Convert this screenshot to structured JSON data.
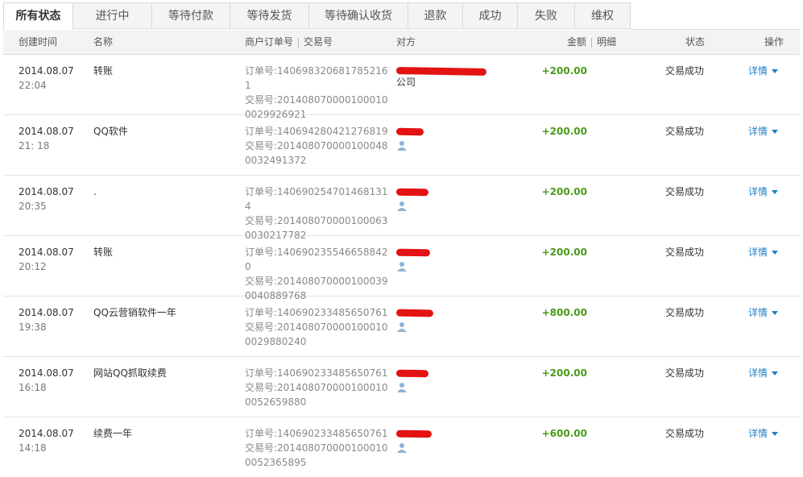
{
  "tabs": [
    "所有状态",
    "进行中",
    "等待付款",
    "等待发货",
    "等待确认收货",
    "退款",
    "成功",
    "失败",
    "维权"
  ],
  "columns": {
    "created": "创建时间",
    "name": "名称",
    "merchant_order": "商户订单号",
    "trade_no": "交易号",
    "party": "对方",
    "amount": "金额",
    "detail": "明细",
    "status": "状态",
    "action": "操作"
  },
  "rows": [
    {
      "date": "2014.08.07",
      "time": "22:04",
      "name": "转账",
      "order": "订单号:140698320681785216​1",
      "trade": "交易号:2014080700001000100029926921",
      "party_tail": "公司",
      "amount": "+200.00",
      "status": "交易成功",
      "op": "详情"
    },
    {
      "date": "2014.08.07",
      "time": "21: 18",
      "name": "QQ软件",
      "order": "订单号:140694280421276819",
      "trade": "交易号:2014080700001000480032491372",
      "party_tail": "",
      "amount": "+200.00",
      "status": "交易成功",
      "op": "详情"
    },
    {
      "date": "2014.08.07",
      "time": "20:35",
      "name": ".",
      "order": "订单号:1406902547014681314",
      "trade": "交易号:2014080700001000630030217782",
      "party_tail": "",
      "amount": "+200.00",
      "status": "交易成功",
      "op": "详情"
    },
    {
      "date": "2014.08.07",
      "time": "20:12",
      "name": "转账",
      "order": "订单号:1406902355466588420",
      "trade": "交易号:2014080700001000390040889768",
      "party_tail": "",
      "amount": "+200.00",
      "status": "交易成功",
      "op": "详情"
    },
    {
      "date": "2014.08.07",
      "time": "19:38",
      "name": "QQ云营销软件一年",
      "order": "订单号:140690233485650761",
      "trade": "交易号:2014080700001000100029880240",
      "party_tail": "",
      "amount": "+800.00",
      "status": "交易成功",
      "op": "详情"
    },
    {
      "date": "2014.08.07",
      "time": "16:18",
      "name": "网站QQ抓取续费",
      "order": "订单号:140690233485650761",
      "trade": "交易号:2014080700001000100052659880",
      "party_tail": "",
      "amount": "+200.00",
      "status": "交易成功",
      "op": "详情"
    },
    {
      "date": "2014.08.07",
      "time": "14:18",
      "name": "续费一年",
      "order": "订单号:140690233485650761",
      "trade": "交易号:2014080700001000100052365895",
      "party_tail": "",
      "amount": "+600.00",
      "status": "交易成功",
      "op": "详情"
    }
  ]
}
